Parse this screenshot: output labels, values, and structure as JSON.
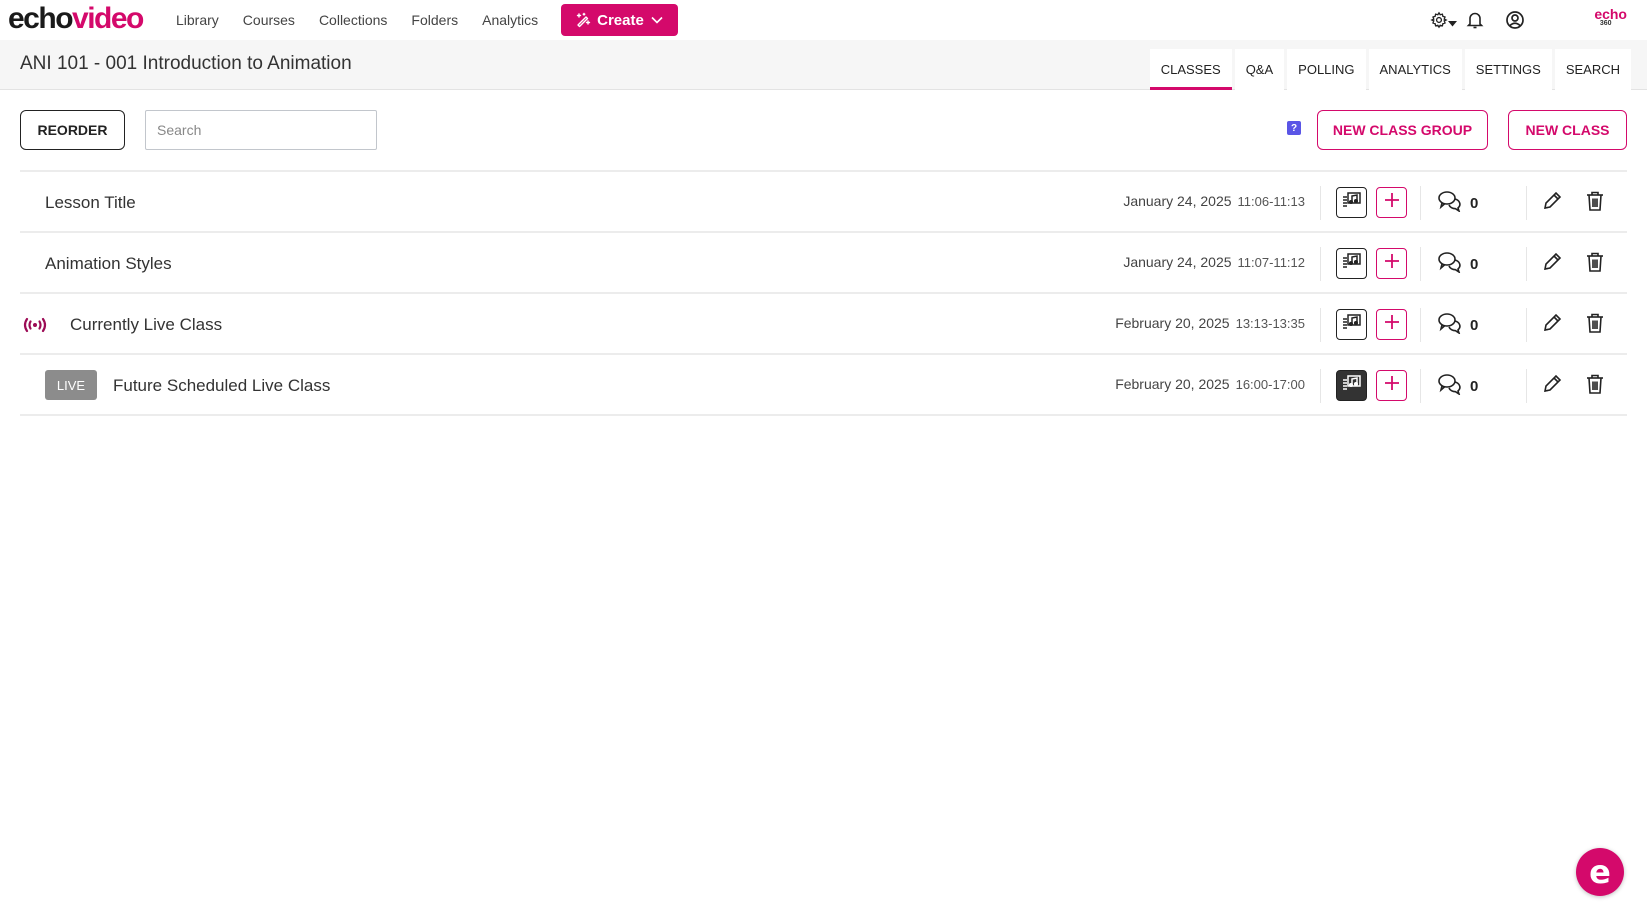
{
  "brand": {
    "echo": "echo",
    "video": "video",
    "accent": "#d4096b",
    "corner_logo": "echo",
    "corner_logo_sub": "360"
  },
  "nav": {
    "links": [
      "Library",
      "Courses",
      "Collections",
      "Folders",
      "Analytics"
    ],
    "create_label": "Create",
    "icons": [
      "settings-icon",
      "notifications-icon",
      "account-icon"
    ]
  },
  "course": {
    "title": "ANI 101 - 001 Introduction to Animation",
    "tabs": [
      {
        "label": "CLASSES",
        "active": true
      },
      {
        "label": "Q&A",
        "active": false
      },
      {
        "label": "POLLING",
        "active": false
      },
      {
        "label": "ANALYTICS",
        "active": false
      },
      {
        "label": "SETTINGS",
        "active": false
      },
      {
        "label": "SEARCH",
        "active": false
      }
    ]
  },
  "toolbar": {
    "reorder_label": "REORDER",
    "search_placeholder": "Search",
    "help_label": "?",
    "new_class_group_label": "NEW CLASS GROUP",
    "new_class_label": "NEW CLASS"
  },
  "classes": [
    {
      "title": "Lesson Title",
      "date": "January 24, 2025",
      "time": "11:06-11:13",
      "comments": "0",
      "status": "none",
      "media_style": "outline"
    },
    {
      "title": "Animation Styles",
      "date": "January 24, 2025",
      "time": "11:07-11:12",
      "comments": "0",
      "status": "none",
      "media_style": "outline"
    },
    {
      "title": "Currently Live Class",
      "date": "February 20, 2025",
      "time": "13:13-13:35",
      "comments": "0",
      "status": "live-now",
      "media_style": "outline"
    },
    {
      "title": "Future Scheduled Live Class",
      "date": "February 20, 2025",
      "time": "16:00-17:00",
      "comments": "0",
      "status": "scheduled-live",
      "badge": "LIVE",
      "media_style": "filled"
    }
  ],
  "chat_fab": {
    "label": "e"
  }
}
